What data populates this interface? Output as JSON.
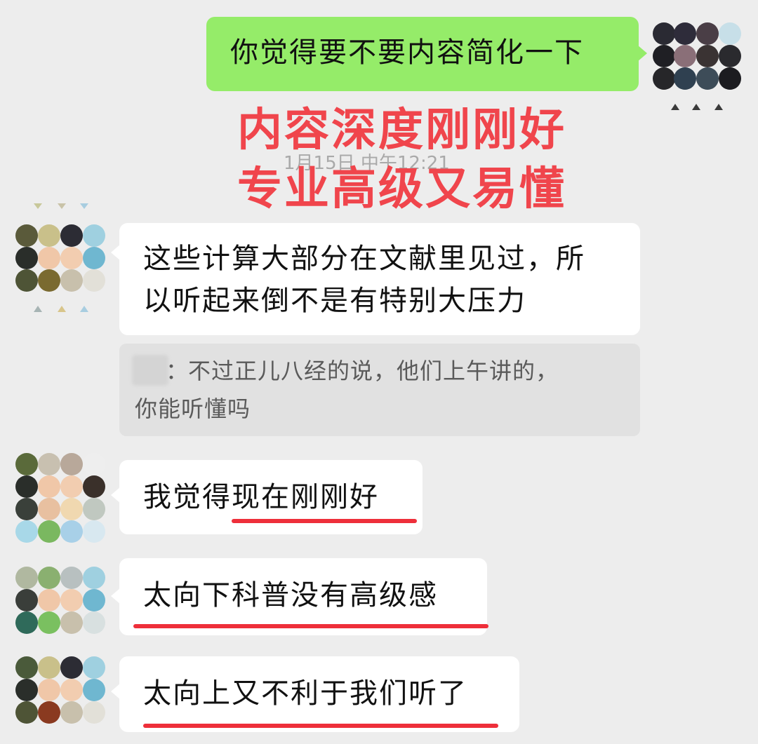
{
  "chat": {
    "timestamp": "1月15日 中午12:21",
    "annotation": {
      "line1": "内容深度刚刚好",
      "line2": "专业高级又易懂",
      "color": "#f0454c"
    },
    "messages": [
      {
        "side": "right",
        "lines": [
          "你觉得要不要内容简化一下"
        ]
      },
      {
        "side": "left",
        "lines": [
          "这些计算大部分在文献里见过，所",
          "以听起来倒不是有特别大压力"
        ]
      },
      {
        "side": "left",
        "lines": [
          "我觉得现在刚刚好"
        ]
      },
      {
        "side": "left",
        "lines": [
          "太向下科普没有高级感"
        ]
      },
      {
        "side": "left",
        "lines": [
          "太向上又不利于我们听了"
        ]
      }
    ],
    "quote": {
      "separator": "：",
      "lines": [
        "不过正儿八经的说，他们上午讲的，",
        "你能听懂吗"
      ]
    }
  },
  "colors": {
    "background": "#ededed",
    "sent_bubble": "#95ec69",
    "received_bubble": "#ffffff",
    "quote_bg": "#e1e1e1",
    "underline": "#ee2f3a"
  }
}
